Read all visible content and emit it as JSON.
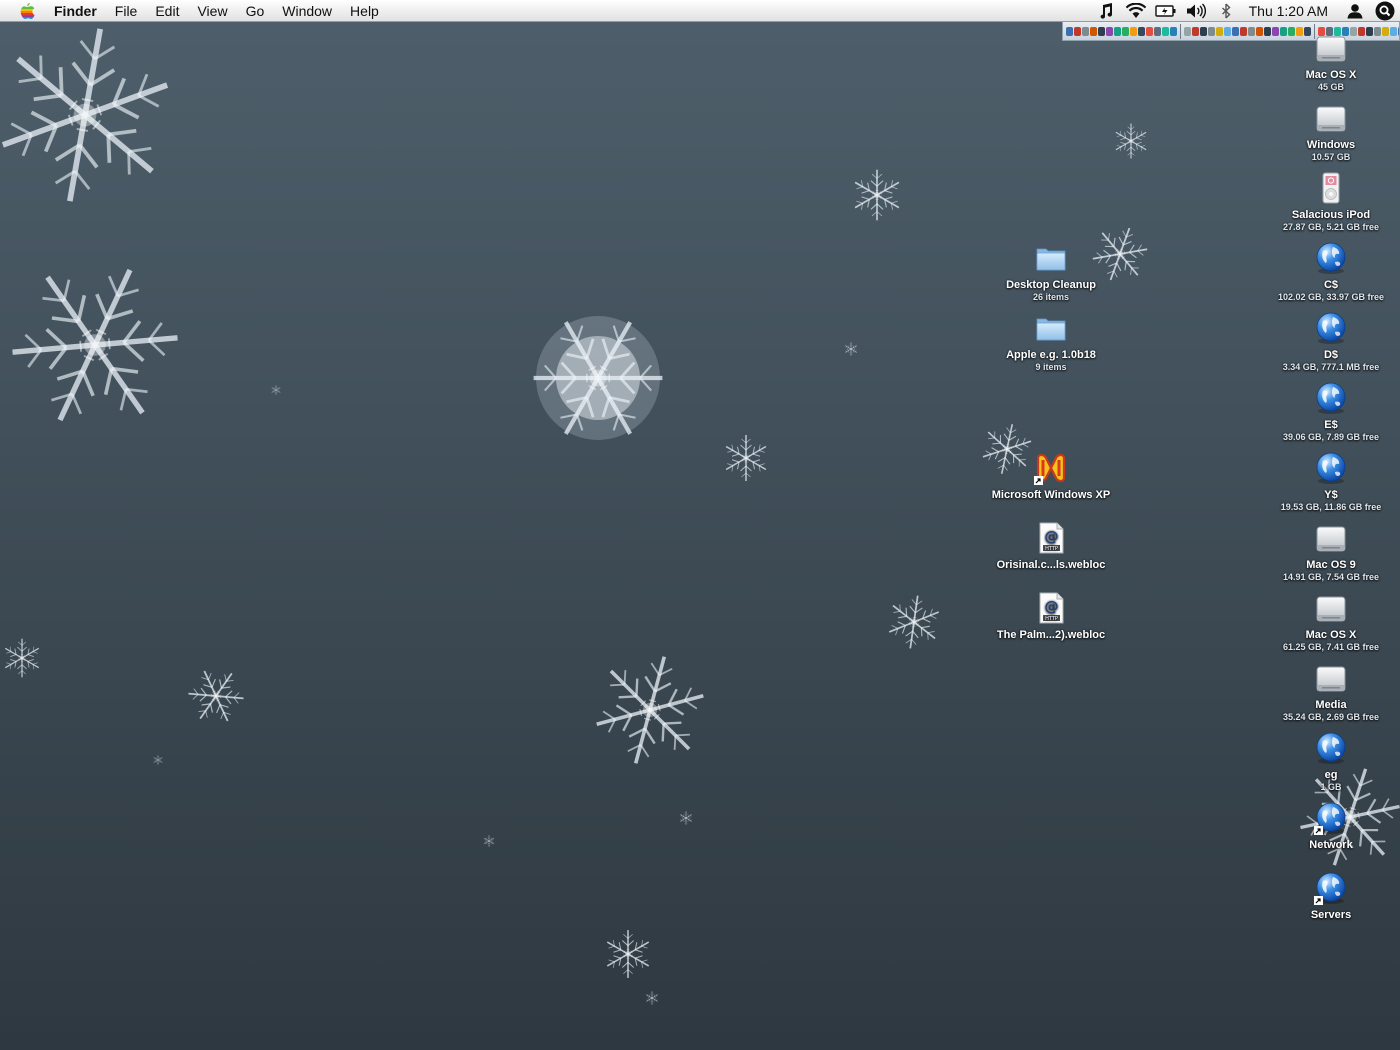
{
  "menubar": {
    "app_name": "Finder",
    "menus": [
      "File",
      "Edit",
      "View",
      "Go",
      "Window",
      "Help"
    ],
    "clock": "Thu 1:20 AM",
    "status_icons": [
      "itunes-note-icon",
      "wifi-icon",
      "battery-icon",
      "volume-icon",
      "bluetooth-icon",
      "user-icon",
      "spotlight-icon"
    ]
  },
  "right_column_icons": [
    {
      "name": "Mac OS X",
      "sub": "45 GB",
      "icon": "hard-drive-icon"
    },
    {
      "name": "Windows",
      "sub": "10.57 GB",
      "icon": "hard-drive-icon"
    },
    {
      "name": "Salacious iPod",
      "sub": "27.87 GB, 5.21 GB free",
      "icon": "ipod-icon"
    },
    {
      "name": "C$",
      "sub": "102.02 GB, 33.97 GB free",
      "icon": "network-globe-icon"
    },
    {
      "name": "D$",
      "sub": "3.34 GB, 777.1 MB free",
      "icon": "network-globe-icon"
    },
    {
      "name": "E$",
      "sub": "39.06 GB, 7.89 GB free",
      "icon": "network-globe-icon"
    },
    {
      "name": "Y$",
      "sub": "19.53 GB, 11.86 GB free",
      "icon": "network-globe-icon"
    },
    {
      "name": "Mac OS 9",
      "sub": "14.91 GB, 7.54 GB free",
      "icon": "hard-drive-icon"
    },
    {
      "name": "Mac OS X",
      "sub": "61.25 GB, 7.41 GB free",
      "icon": "hard-drive-icon"
    },
    {
      "name": "Media",
      "sub": "35.24 GB, 2.69 GB free",
      "icon": "hard-drive-icon"
    },
    {
      "name": "eg",
      "sub": "1 GB",
      "icon": "network-globe-icon"
    },
    {
      "name": "Network",
      "sub": "",
      "icon": "network-globe-icon"
    },
    {
      "name": "Servers",
      "sub": "",
      "icon": "network-globe-icon"
    }
  ],
  "left_column_icons": [
    {
      "name": "Desktop Cleanup",
      "sub": "26 items",
      "icon": "folder-icon"
    },
    {
      "name": "Apple e.g. 1.0b18",
      "sub": "9 items",
      "icon": "folder-icon"
    },
    {
      "name": "Microsoft Windows XP",
      "sub": "",
      "icon": "parallels-app-icon"
    },
    {
      "name": "Orisinal.c...ls.webloc",
      "sub": "",
      "icon": "webloc-icon"
    },
    {
      "name": "The Palm...2).webloc",
      "sub": "",
      "icon": "webloc-icon"
    }
  ],
  "colors": {
    "desktop_top": "#4e5f6b",
    "desktop_bottom": "#2e3840",
    "globe_blue": "#2f7fd8",
    "folder_blue": "#a9cdee"
  }
}
